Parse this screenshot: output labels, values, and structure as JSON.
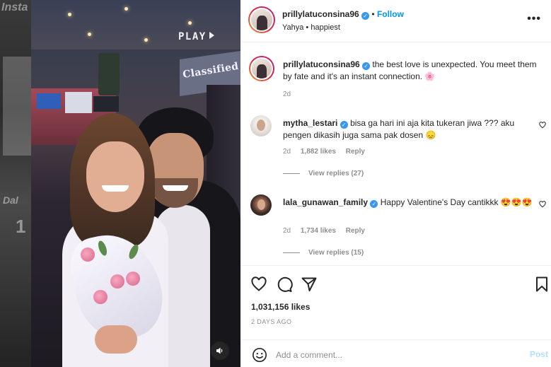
{
  "background": {
    "left_texts": [
      "Insta",
      "Dal",
      "1"
    ]
  },
  "media": {
    "overlay_label": "PLAY",
    "sign_text": "Classified",
    "sound_icon": "speaker-icon"
  },
  "post": {
    "author": "prillylatuconsina96",
    "follow_label": "Follow",
    "separator": "•",
    "subtitle": "Yahya • happiest",
    "caption": "the best love is unexpected. You meet them by fate and it's an instant connection. 🌸",
    "caption_time": "2d",
    "likes": "1,031,156 likes",
    "date": "2 DAYS AGO"
  },
  "comments": [
    {
      "user": "mytha_lestari",
      "text": "bisa ga hari ini aja kita tukeran jiwa ??? aku pengen dikasih juga sama pak dosen 😞",
      "time": "2d",
      "likes": "1,882 likes",
      "reply_label": "Reply",
      "view_replies": "View replies (27)"
    },
    {
      "user": "lala_gunawan_family",
      "text": "Happy Valentine's Day cantikkk 😍😍😍",
      "time": "2d",
      "likes": "1,734 likes",
      "reply_label": "Reply",
      "view_replies": "View replies (15)"
    }
  ],
  "comment_box": {
    "placeholder": "Add a comment...",
    "post_label": "Post"
  },
  "colors": {
    "accent": "#0095f6",
    "verified": "#3897f0",
    "muted": "#8e8e8e"
  }
}
